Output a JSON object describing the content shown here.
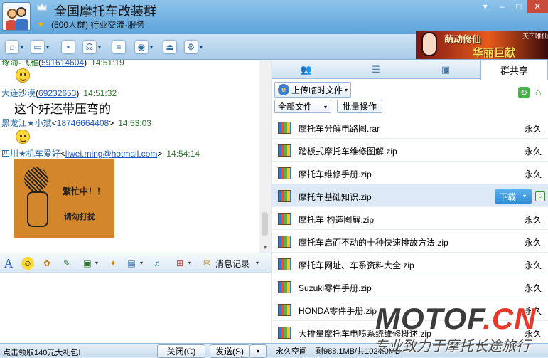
{
  "window": {
    "title": "全国摩托车改装群",
    "subtitle": "(500人群) 行业交流-服务",
    "controls": [
      "▾",
      "–",
      "□",
      "✕"
    ]
  },
  "toolbar": {
    "icons": [
      "home-icon",
      "folder-icon",
      "save-icon",
      "talk-icon",
      "notice-icon",
      "location-icon",
      "vote-icon",
      "settings-icon"
    ]
  },
  "ad": {
    "line1": "萌动修仙",
    "line2": "华丽巨献",
    "line3": "天下唯仙"
  },
  "chat": {
    "messages": [
      {
        "sender": "琢海-飞雁",
        "id": "591614604",
        "time": "14:51:19"
      },
      {
        "sender": "大连沙漠",
        "id": "69232653",
        "time": "14:51:32",
        "text": "这个好还带压弯的"
      },
      {
        "sender": "黑龙江★小斌",
        "id": "18746664408",
        "time": "14:53:03"
      },
      {
        "sender": "四川★机车爱好",
        "id": "liwei.ming@hotmail.com",
        "time": "14:54:14"
      }
    ],
    "busy_image": {
      "line1": "繁忙中！！",
      "line2": "请勿打扰"
    }
  },
  "input_toolbar": {
    "font": "A",
    "message_log": "消息记录"
  },
  "bottom": {
    "promo": "点击领取140元大礼包!",
    "close_label": "关闭(C)",
    "send_label": "发送(S)",
    "storage_label": "永久空间",
    "storage_value": "剩988.1MB/共1024.0MB"
  },
  "right_panel": {
    "tabs": [
      "👥",
      "☰",
      "▣",
      "群共享"
    ],
    "upload_label": "上传临时文件",
    "filter_label": "全部文件",
    "batch_label": "批量操作",
    "download_label": "下载",
    "files": [
      {
        "name": "摩托车分解电路图.rar",
        "expiry": "永久"
      },
      {
        "name": "踏板式摩托车维修图解.zip",
        "expiry": "永久"
      },
      {
        "name": "摩托车维修手册.zip",
        "expiry": "永久"
      },
      {
        "name": "摩托车基础知识.zip",
        "expiry": ""
      },
      {
        "name": "摩托车  构造图解.zip",
        "expiry": "永久"
      },
      {
        "name": "摩托车启而不动的十种快速排故方法.zip",
        "expiry": "永久"
      },
      {
        "name": "摩托车网址、车系资料大全.zip",
        "expiry": "永久"
      },
      {
        "name": "Suzuki零件手册.zip",
        "expiry": "永久"
      },
      {
        "name": "HONDA零件手册.zip",
        "expiry": "永久"
      },
      {
        "name": "大排量摩托车电喷系统维修概述.zip",
        "expiry": "永久"
      }
    ]
  },
  "watermark": {
    "brand_a": "MOTOF",
    "brand_b": ".CN",
    "slogan": "专业致力于摩托长途旅行"
  }
}
